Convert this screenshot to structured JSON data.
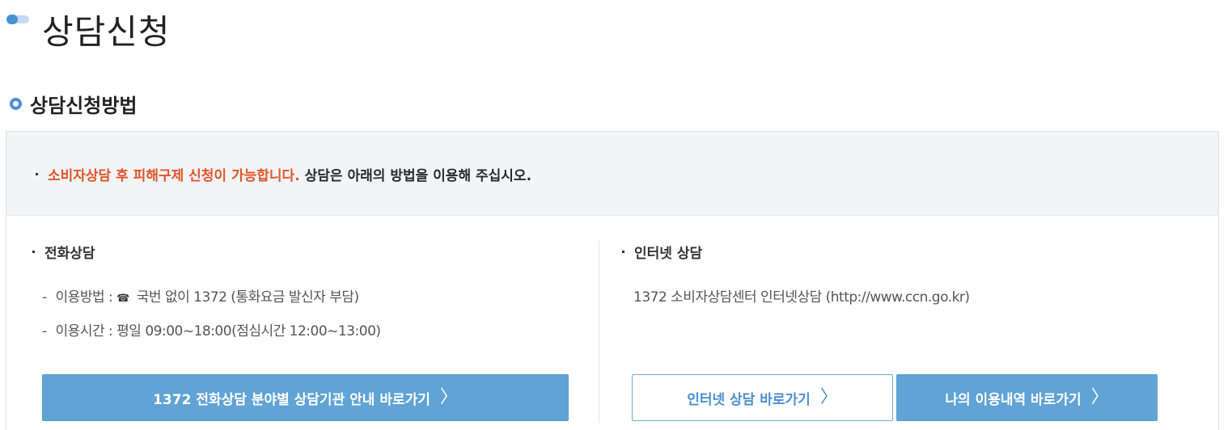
{
  "page": {
    "title": "상담신청"
  },
  "section": {
    "title": "상담신청방법"
  },
  "notice": {
    "highlight": "소비자상담 후 피해구제 신청이 가능합니다.",
    "rest": "상담은 아래의 방법을 이용해 주십시오."
  },
  "phone": {
    "title": "전화상담",
    "usage_label": "이용방법 :",
    "usage_value": "국번 없이  1372 (통화요금 발신자 부담)",
    "hours_label": "이용시간 :",
    "hours_value": "평일 09:00~18:00(점심시간 12:00~13:00)",
    "button_label": "1372 전화상담 분야별 상담기관 안내 바로가기"
  },
  "internet": {
    "title": "인터넷 상담",
    "description": "1372 소비자상담센터 인터넷상담 (http://www.ccn.go.kr)",
    "button_label": "인터넷 상담 바로가기",
    "history_button_label": "나의 이용내역 바로가기"
  },
  "icons": {
    "title_mark": "toggle-pill-icon",
    "section_mark": "ring-icon",
    "phone": "telephone-icon",
    "chevron": "chevron-right-icon"
  },
  "colors": {
    "accent": "#4a90d9",
    "highlight": "#e0562b",
    "button_fill": "#60a3d4",
    "notice_bg": "#f2f4f5"
  }
}
